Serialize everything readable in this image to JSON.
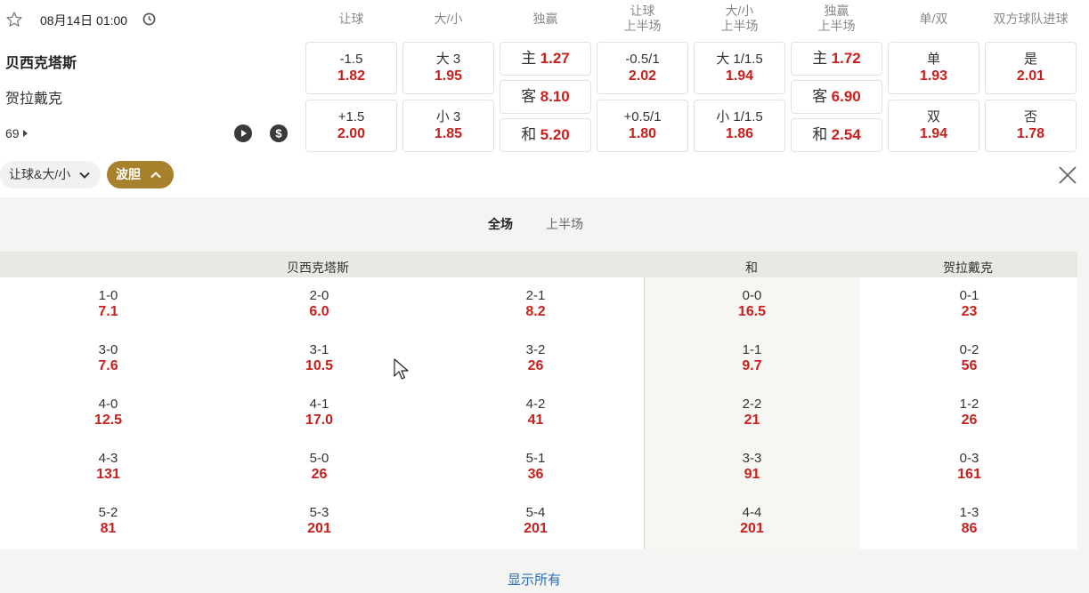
{
  "match": {
    "datetime": "08月14日 01:00",
    "home": "贝西克塔斯",
    "away": "贺拉戴克",
    "minute": "69"
  },
  "columns": [
    {
      "l1": "让球",
      "l2": ""
    },
    {
      "l1": "大/小",
      "l2": ""
    },
    {
      "l1": "独赢",
      "l2": ""
    },
    {
      "l1": "让球",
      "l2": "上半场"
    },
    {
      "l1": "大/小",
      "l2": "上半场"
    },
    {
      "l1": "独赢",
      "l2": "上半场"
    },
    {
      "l1": "单/双",
      "l2": ""
    },
    {
      "l1": "双方球队进球",
      "l2": ""
    }
  ],
  "odds": {
    "hdp_home": {
      "label": "-1.5",
      "value": "1.82"
    },
    "hdp_away": {
      "label": "+1.5",
      "value": "2.00"
    },
    "ou_over": {
      "label": "大 3",
      "value": "1.95"
    },
    "ou_under": {
      "label": "小 3",
      "value": "1.85"
    },
    "x12_home": {
      "label": "主",
      "value": "1.27"
    },
    "x12_away": {
      "label": "客",
      "value": "8.10"
    },
    "x12_draw": {
      "label": "和",
      "value": "5.20"
    },
    "h1_hdp_home": {
      "label": "-0.5/1",
      "value": "2.02"
    },
    "h1_hdp_away": {
      "label": "+0.5/1",
      "value": "1.80"
    },
    "h1_ou_over": {
      "label": "大 1/1.5",
      "value": "1.94"
    },
    "h1_ou_under": {
      "label": "小 1/1.5",
      "value": "1.86"
    },
    "h1_x12_home": {
      "label": "主",
      "value": "1.72"
    },
    "h1_x12_away": {
      "label": "客",
      "value": "6.90"
    },
    "h1_x12_draw": {
      "label": "和",
      "value": "2.54"
    },
    "oe_odd": {
      "label": "单",
      "value": "1.93"
    },
    "oe_even": {
      "label": "双",
      "value": "1.94"
    },
    "btts_yes": {
      "label": "是",
      "value": "2.01"
    },
    "btts_no": {
      "label": "否",
      "value": "1.78"
    }
  },
  "filters": {
    "chip1": "让球&大/小",
    "chip2": "波胆"
  },
  "tabs": {
    "full": "全场",
    "half": "上半场"
  },
  "table": {
    "home_header": "贝西克塔斯",
    "draw_header": "和",
    "away_header": "贺拉戴克",
    "home_col1": [
      {
        "score": "1-0",
        "odds": "7.1"
      },
      {
        "score": "3-0",
        "odds": "7.6"
      },
      {
        "score": "4-0",
        "odds": "12.5"
      },
      {
        "score": "4-3",
        "odds": "131"
      },
      {
        "score": "5-2",
        "odds": "81"
      }
    ],
    "home_col2": [
      {
        "score": "2-0",
        "odds": "6.0"
      },
      {
        "score": "3-1",
        "odds": "10.5"
      },
      {
        "score": "4-1",
        "odds": "17.0"
      },
      {
        "score": "5-0",
        "odds": "26"
      },
      {
        "score": "5-3",
        "odds": "201"
      }
    ],
    "home_col3": [
      {
        "score": "2-1",
        "odds": "8.2"
      },
      {
        "score": "3-2",
        "odds": "26"
      },
      {
        "score": "4-2",
        "odds": "41"
      },
      {
        "score": "5-1",
        "odds": "36"
      },
      {
        "score": "5-4",
        "odds": "201"
      }
    ],
    "draw": [
      {
        "score": "0-0",
        "odds": "16.5"
      },
      {
        "score": "1-1",
        "odds": "9.7"
      },
      {
        "score": "2-2",
        "odds": "21"
      },
      {
        "score": "3-3",
        "odds": "91"
      },
      {
        "score": "4-4",
        "odds": "201"
      }
    ],
    "away": [
      {
        "score": "0-1",
        "odds": "23"
      },
      {
        "score": "0-2",
        "odds": "56"
      },
      {
        "score": "1-2",
        "odds": "26"
      },
      {
        "score": "0-3",
        "odds": "161"
      },
      {
        "score": "1-3",
        "odds": "86"
      }
    ]
  },
  "show_all": "显示所有",
  "colors": {
    "odds_red": "#c8201d",
    "accent_gold": "#a8812c",
    "link_blue": "#2a6cb8"
  }
}
